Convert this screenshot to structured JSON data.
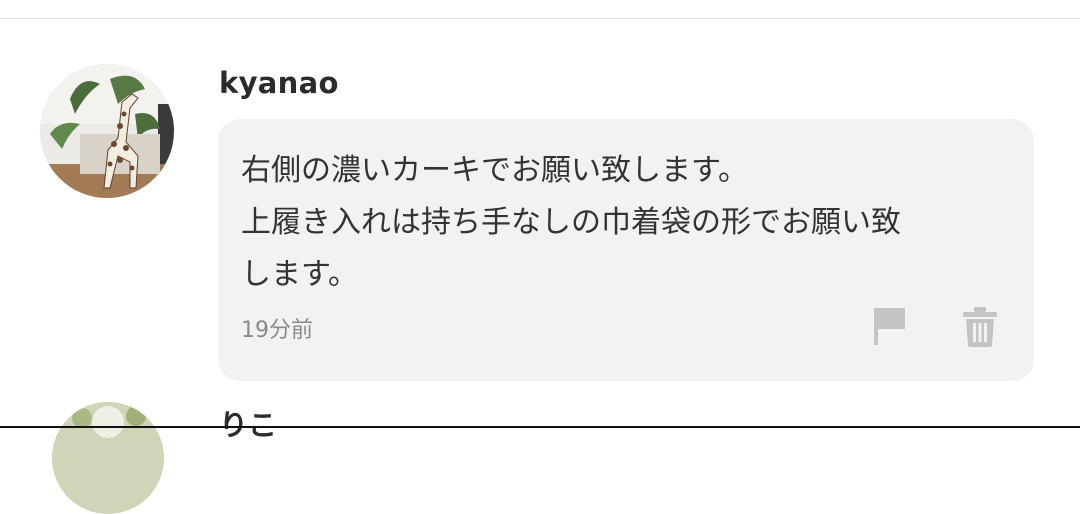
{
  "comments": [
    {
      "username": "kyanao",
      "avatar_icon": "giraffe-figurine-photo",
      "lines": [
        "右側の濃いカーキでお願い致します。",
        "上履き入れは持ち手なしの巾着袋の形でお願い致",
        "します。"
      ],
      "timestamp": "19分前",
      "actions": {
        "report_icon": "flag-icon",
        "delete_icon": "trash-icon"
      }
    },
    {
      "username": "りこ",
      "avatar_icon": "flower-photo"
    }
  ],
  "colors": {
    "bubble_background": "#f2f2f2",
    "icon_gray": "#c4c4c4",
    "timestamp_gray": "#8a8a8a",
    "text": "#333333"
  }
}
